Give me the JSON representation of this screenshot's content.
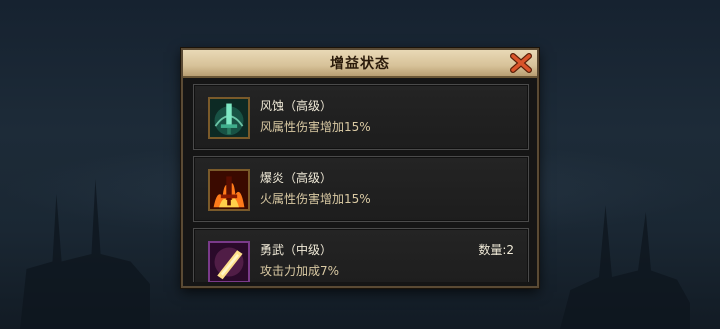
{
  "dialog": {
    "title": "增益状态"
  },
  "buffs": [
    {
      "name": "风蚀（高级）",
      "description": "风属性伤害增加15%",
      "icon": "wind-sword-icon",
      "icon_color": "#4fd4a0"
    },
    {
      "name": "爆炎（高级）",
      "description": "火属性伤害增加15%",
      "icon": "fire-sword-icon",
      "icon_color": "#ff6a1a"
    },
    {
      "name": "勇武（中级）",
      "description": "攻击力加成7%",
      "count": "数量:2",
      "icon": "golden-blade-icon",
      "icon_color": "#f5c542"
    }
  ],
  "colors": {
    "title_bar": "#d7c299",
    "close_accent": "#c8461c"
  }
}
